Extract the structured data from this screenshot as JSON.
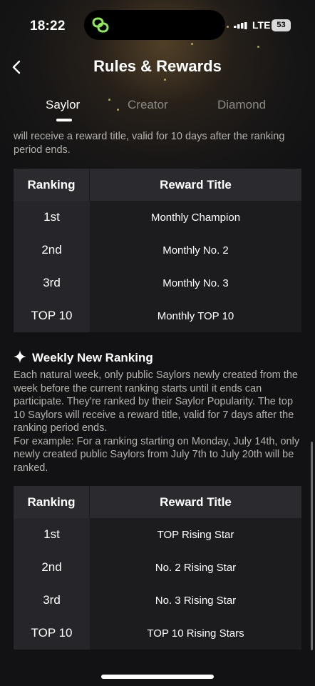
{
  "status_bar": {
    "time": "18:22",
    "network": "LTE",
    "battery": "53"
  },
  "header": {
    "title": "Rules & Rewards"
  },
  "tabs": [
    {
      "label": "Saylor",
      "active": true
    },
    {
      "label": "Creator",
      "active": false
    },
    {
      "label": "Diamond",
      "active": false
    }
  ],
  "intro_text": "will receive a reward title, valid for 10 days after the ranking period ends.",
  "monthly_table": {
    "headers": [
      "Ranking",
      "Reward Title"
    ],
    "rows": [
      [
        "1st",
        "Monthly Champion"
      ],
      [
        "2nd",
        "Monthly No. 2"
      ],
      [
        "3rd",
        "Monthly No. 3"
      ],
      [
        "TOP 10",
        "Monthly TOP 10"
      ]
    ]
  },
  "weekly": {
    "heading": "Weekly New Ranking",
    "description": "Each natural week, only public Saylors newly created from the week before the current ranking starts until it ends can participate. They're ranked by their Saylor Popularity. The top 10 Saylors will receive a reward title, valid for 7 days after the ranking period ends.",
    "example": "For example: For a ranking starting on Monday, July 14th, only newly created public Saylors from July 7th to July 20th will be ranked."
  },
  "weekly_table": {
    "headers": [
      "Ranking",
      "Reward Title"
    ],
    "rows": [
      [
        "1st",
        "TOP Rising Star"
      ],
      [
        "2nd",
        "No. 2 Rising Star"
      ],
      [
        "3rd",
        "No. 3 Rising Star"
      ],
      [
        "TOP 10",
        "TOP 10 Rising Stars"
      ]
    ]
  },
  "colors": {
    "background": "#121214",
    "accent_green": "#8ee85a",
    "muted_text": "#b6b3ae"
  }
}
